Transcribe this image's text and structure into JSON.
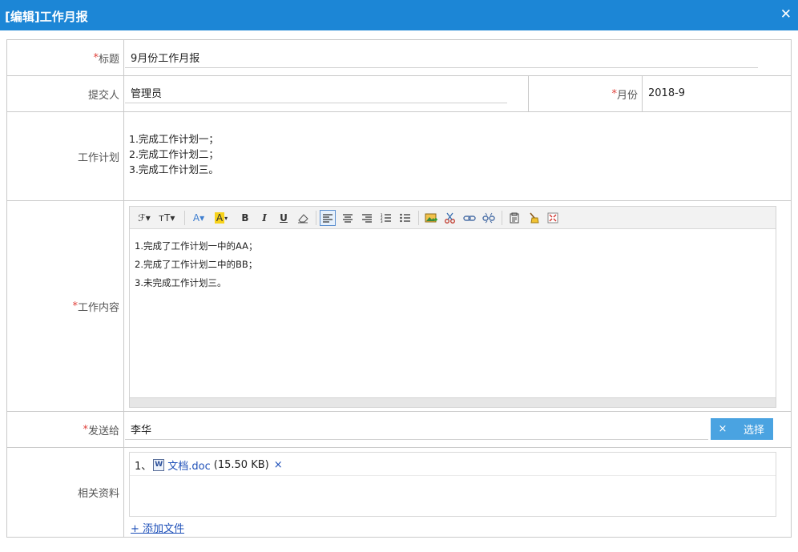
{
  "window": {
    "title": "[编辑]工作月报",
    "close_glyph": "✕"
  },
  "fields": {
    "title": {
      "label": "标题",
      "required": "*",
      "value": "9月份工作月报"
    },
    "submitter": {
      "label": "提交人",
      "value": "管理员"
    },
    "month": {
      "label": "月份",
      "required": "*",
      "value": "2018-9"
    },
    "plan": {
      "label": "工作计划",
      "lines": [
        "1.完成工作计划一；",
        "2.完成工作计划二；",
        "3.完成工作计划三。"
      ]
    },
    "content": {
      "label": "工作内容",
      "required": "*",
      "lines": [
        "1.完成了工作计划一中的AA；",
        "2.完成了工作计划二中的BB；",
        "3.未完成工作计划三。"
      ]
    },
    "send_to": {
      "label": "发送给",
      "required": "*",
      "value": "李华",
      "clear_label": "×",
      "choose_label": "选择"
    },
    "attachments": {
      "label": "相关资料",
      "items": [
        {
          "index": "1、",
          "name": "文档.doc",
          "size": "(15.50 KB)",
          "remove": "×"
        }
      ],
      "add_label": "+ 添加文件"
    }
  },
  "toolbar": {
    "font_family": "ℱ▾",
    "font_size": "тT▾",
    "font_color": "A▾",
    "bg_color": "A",
    "bold": "B",
    "italic": "I",
    "underline": "U"
  },
  "colors": {
    "titlebar": "#1c86d6",
    "button": "#4aa3e1",
    "required": "#e0403a",
    "link": "#1d4fb8",
    "highlight": "#f7d21b"
  }
}
